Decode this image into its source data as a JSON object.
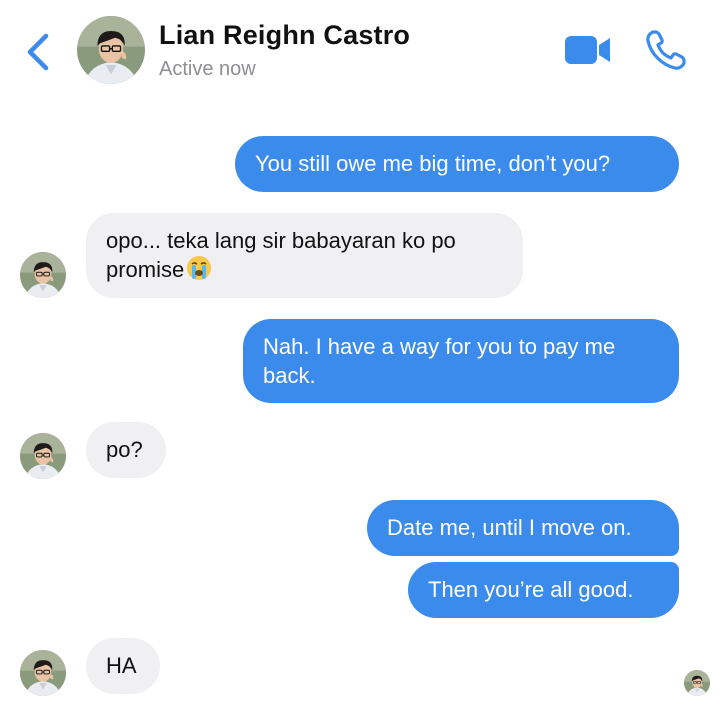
{
  "header": {
    "contact_name": "Lian Reighn Castro",
    "status": "Active now",
    "icons": {
      "back": "chevron-left-icon",
      "video": "video-camera-icon",
      "call": "phone-icon"
    },
    "accent_color": "#3b8bec"
  },
  "messages": [
    {
      "from": "me",
      "text": "You still owe me big time, don’t you?"
    },
    {
      "from": "contact",
      "text": "opo... teka lang sir babayaran ko po promise",
      "emoji": "loudly-crying-face"
    },
    {
      "from": "me",
      "text": "Nah. I have a way for you to pay me back."
    },
    {
      "from": "contact",
      "text": "po?"
    },
    {
      "from": "me",
      "text": "Date me, until I move on."
    },
    {
      "from": "me",
      "text": "Then you’re all good."
    },
    {
      "from": "contact",
      "text": "HA"
    }
  ],
  "colors": {
    "outgoing_bubble": "#3b8bec",
    "incoming_bubble": "#f0f0f2",
    "status_text": "#8e8e93"
  }
}
